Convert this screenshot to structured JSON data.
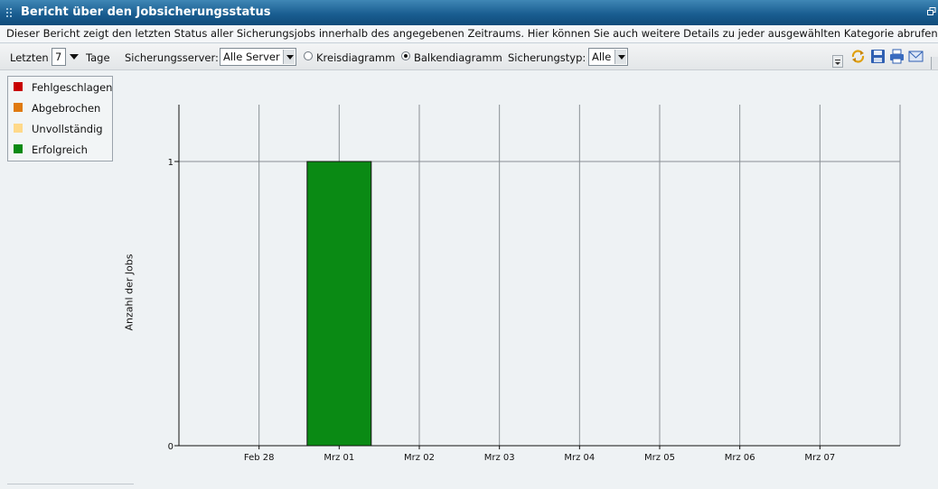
{
  "window": {
    "title": "Bericht über den Jobsicherungsstatus",
    "description": "Dieser Bericht zeigt den letzten Status aller Sicherungsjobs innerhalb des angegebenen Zeitraums. Hier können Sie auch weitere Details zu jeder ausgewählten Kategorie abrufen."
  },
  "toolbar": {
    "days_prefix": "Letzten",
    "days_value": "7",
    "days_suffix": "Tage",
    "server_label": "Sicherungsserver:",
    "server_value": "Alle Server",
    "pie_label": "Kreisdiagramm",
    "bar_label": "Balkendiagramm",
    "chart_mode_selected": "Balkendiagramm",
    "type_label": "Sicherungstyp:",
    "type_value": "Alle",
    "icons": [
      "menu-icon",
      "refresh-icon",
      "save-icon",
      "print-icon",
      "email-icon"
    ]
  },
  "legend": [
    {
      "label": "Fehlgeschlagen",
      "color": "#c80000"
    },
    {
      "label": "Abgebrochen",
      "color": "#e07a10"
    },
    {
      "label": "Unvollständig",
      "color": "#ffd98a"
    },
    {
      "label": "Erfolgreich",
      "color": "#0a8a14"
    }
  ],
  "chart_data": {
    "type": "bar",
    "categories": [
      "Feb 28",
      "Mrz 01",
      "Mrz 02",
      "Mrz 03",
      "Mrz 04",
      "Mrz 05",
      "Mrz 06",
      "Mrz 07"
    ],
    "series": [
      {
        "name": "Fehlgeschlagen",
        "values": [
          0,
          0,
          0,
          0,
          0,
          0,
          0,
          0
        ],
        "color": "#c80000"
      },
      {
        "name": "Abgebrochen",
        "values": [
          0,
          0,
          0,
          0,
          0,
          0,
          0,
          0
        ],
        "color": "#e07a10"
      },
      {
        "name": "Unvollständig",
        "values": [
          0,
          0,
          0,
          0,
          0,
          0,
          0,
          0
        ],
        "color": "#ffd98a"
      },
      {
        "name": "Erfolgreich",
        "values": [
          0,
          1,
          0,
          0,
          0,
          0,
          0,
          0
        ],
        "color": "#0a8a14"
      }
    ],
    "ylabel": "Anzahl der Jobs",
    "yticks": [
      0,
      1
    ],
    "ylim": [
      0,
      1.2
    ],
    "grid": true,
    "legend_position": "top-left"
  }
}
